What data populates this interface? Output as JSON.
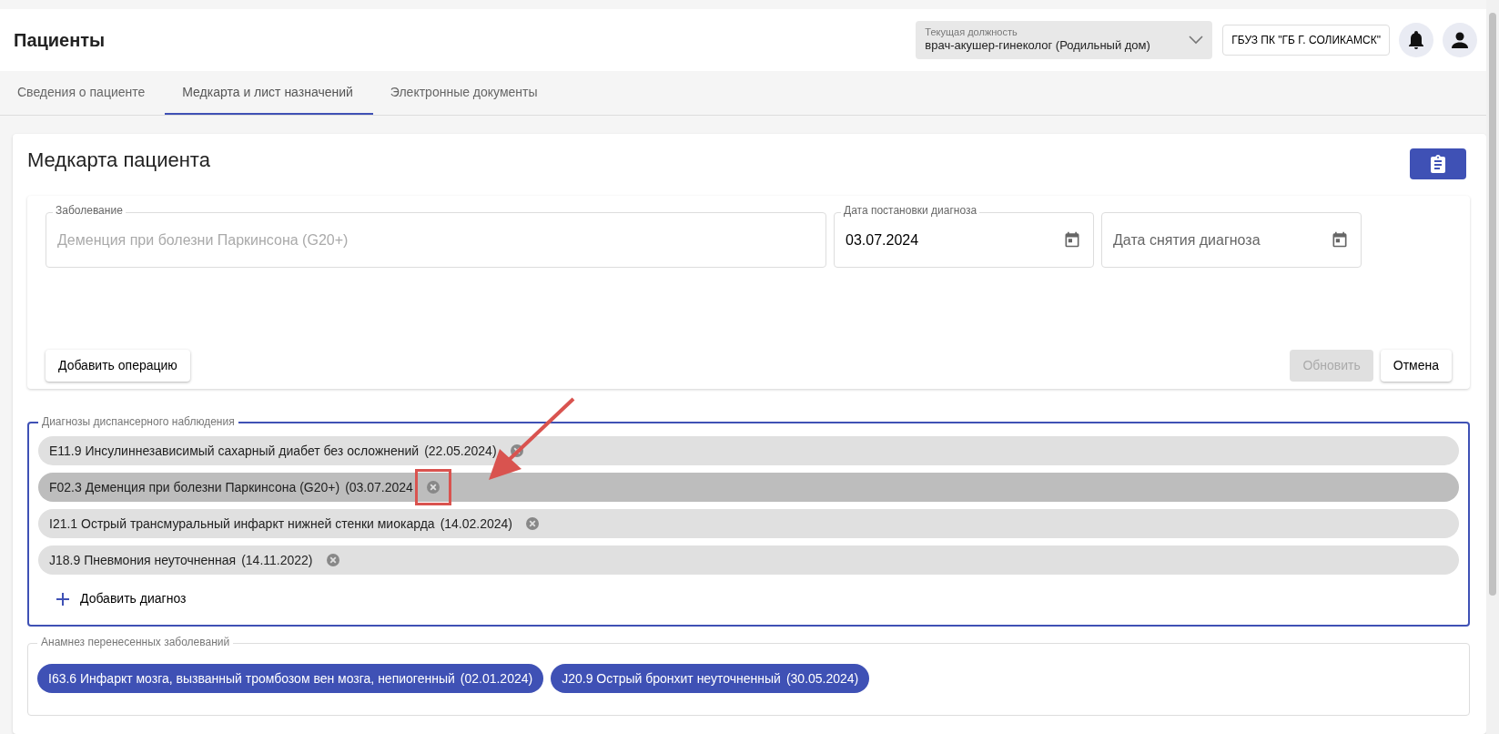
{
  "header": {
    "title": "Пациенты",
    "position": {
      "label": "Текущая должность",
      "value": "врач-акушер-гинеколог (Родильный дом)"
    },
    "organization": "ГБУЗ ПК \"ГБ Г. СОЛИКАМСК\""
  },
  "tabs": [
    {
      "label": "Сведения о пациенте",
      "selected": false
    },
    {
      "label": "Медкарта и лист назначений",
      "selected": true
    },
    {
      "label": "Электронные документы",
      "selected": false
    }
  ],
  "card": {
    "title": "Медкарта пациента",
    "form": {
      "disease": {
        "label": "Заболевание",
        "value": "Деменция при болезни Паркинсона (G20+)",
        "disabled": true
      },
      "diagnosis_date": {
        "label": "Дата постановки диагноза",
        "value": "03.07.2024"
      },
      "removal_date": {
        "placeholder": "Дата снятия диагноза"
      },
      "buttons": [
        {
          "label": "Добавить операцию",
          "disabled": false
        },
        {
          "label": "Обновить",
          "disabled": true
        },
        {
          "label": "Отмена",
          "disabled": false
        }
      ]
    },
    "dispensary": {
      "legend": "Диагнозы диспансерного наблюдения",
      "chips": [
        {
          "text": "E11.9 Инсулиннезависимый сахарный диабет без осложнений",
          "date": "(22.05.2024)",
          "selected": false,
          "annotated": false
        },
        {
          "text": "F02.3 Деменция при болезни Паркинсона (G20+)",
          "date": "(03.07.2024",
          "selected": true,
          "annotated": true
        },
        {
          "text": "I21.1 Острый трансмуральный инфаркт нижней стенки миокарда",
          "date": "(14.02.2024)",
          "selected": false,
          "annotated": false
        },
        {
          "text": "J18.9 Пневмония неуточненная",
          "date": "(14.11.2022)",
          "selected": false,
          "annotated": false
        }
      ],
      "add_label": "Добавить диагноз"
    },
    "history": {
      "legend": "Анамнез перенесенных заболеваний",
      "chips": [
        {
          "text": "I63.6 Инфаркт мозга, вызванный тромбозом вен мозга, непиогенный",
          "date": "(02.01.2024)"
        },
        {
          "text": "J20.9 Острый бронхит неуточненный",
          "date": "(30.05.2024)"
        }
      ]
    }
  },
  "annotation": {
    "arrow": true
  }
}
